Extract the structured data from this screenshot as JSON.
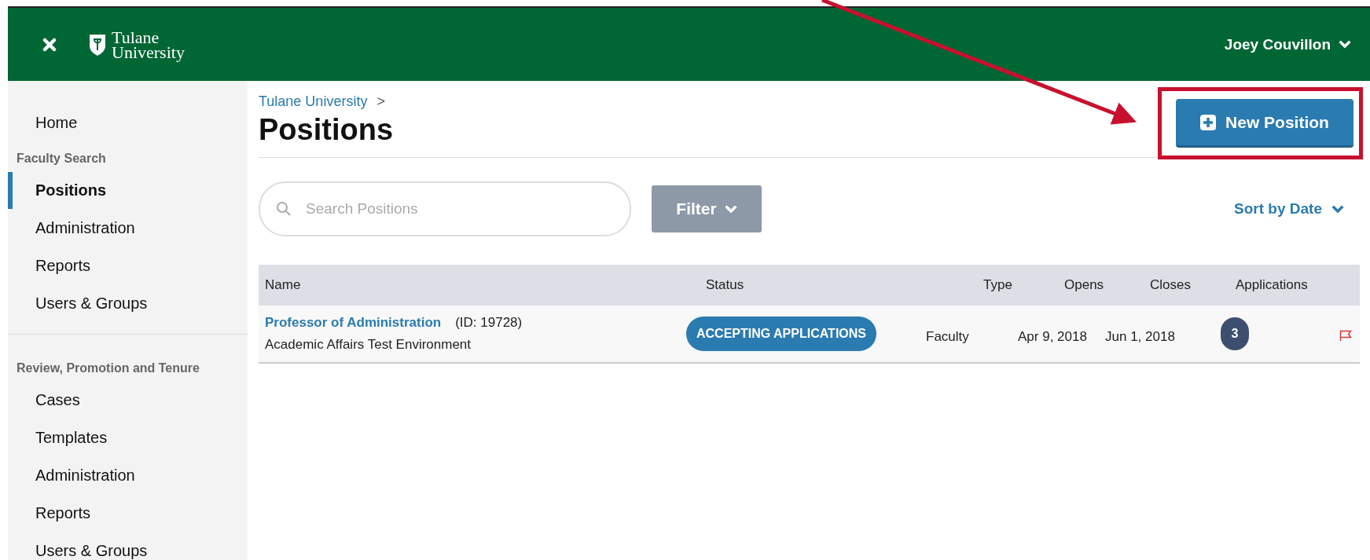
{
  "header": {
    "logo": [
      "Tulane",
      "University"
    ],
    "user": "Joey Couvillon"
  },
  "sidebar": {
    "sections": [
      {
        "items": [
          {
            "label": "Home",
            "selected": false
          }
        ]
      },
      {
        "heading": "Faculty Search",
        "items": [
          {
            "label": "Positions",
            "selected": true
          },
          {
            "label": "Administration",
            "selected": false
          },
          {
            "label": "Reports",
            "selected": false
          },
          {
            "label": "Users & Groups",
            "selected": false
          }
        ]
      },
      {
        "heading": "Review, Promotion and Tenure",
        "items": [
          {
            "label": "Cases",
            "selected": false
          },
          {
            "label": "Templates",
            "selected": false
          },
          {
            "label": "Administration",
            "selected": false
          },
          {
            "label": "Reports",
            "selected": false
          },
          {
            "label": "Users & Groups",
            "selected": false
          }
        ]
      }
    ]
  },
  "breadcrumb": "Tulane University",
  "breadcrumb_separator": ">",
  "title": "Positions",
  "new_button": "New Position",
  "search": {
    "placeholder": "Search Positions"
  },
  "filter_button": "Filter",
  "sort": "Sort by Date",
  "table": {
    "columns": [
      "Name",
      "Status",
      "Type",
      "Opens",
      "Closes",
      "Applications"
    ],
    "rows": [
      {
        "name": "Professor of Administration",
        "id": "(ID: 19728)",
        "department": "Academic Affairs Test Environment",
        "status": "ACCEPTING APPLICATIONS",
        "type": "Faculty",
        "opens": "Apr 9, 2018",
        "closes": "Jun 1, 2018",
        "applications": "3",
        "flagged": true
      }
    ]
  }
}
